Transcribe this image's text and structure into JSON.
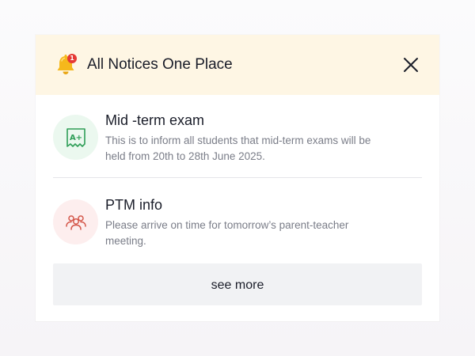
{
  "header": {
    "title": "All Notices One Place",
    "notification_count": "1",
    "icon": "bell-icon",
    "close_icon": "close-icon",
    "background_color": "#fef6e4"
  },
  "notices": [
    {
      "title": "Mid -term exam",
      "body": "This is to inform all students that mid-term exams will be held from 20th to 28th June 2025.",
      "icon": "exam-grade-icon",
      "icon_color": "#2e9e57",
      "icon_background": "#ebf8ef"
    },
    {
      "title": "PTM info",
      "body": "Please arrive on time for tomorrow’s parent-teacher meeting.",
      "icon": "parents-group-icon",
      "icon_color": "#d4574a",
      "icon_background": "#fdeeee"
    }
  ],
  "footer": {
    "see_more_label": "see more"
  },
  "colors": {
    "bell": "#f5b81c",
    "badge": "#e53935",
    "text_primary": "#1a1d29",
    "text_secondary": "#7a7d88",
    "button_background": "#f1f2f4"
  }
}
